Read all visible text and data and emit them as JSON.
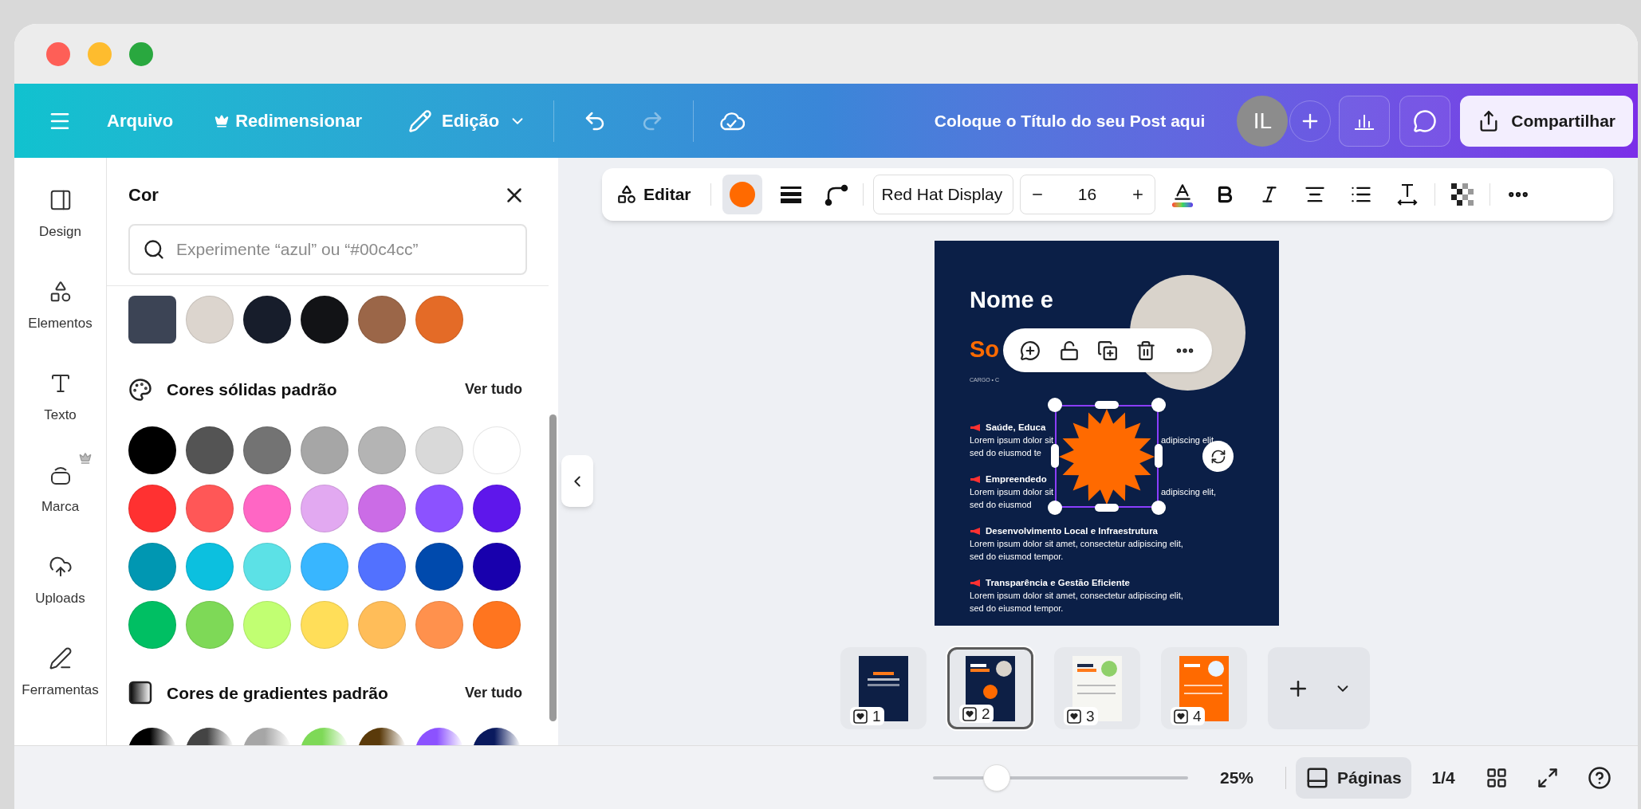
{
  "window": {
    "traffic_lights": [
      {
        "color": "#fe5f57"
      },
      {
        "color": "#febc2e"
      },
      {
        "color": "#29a83f"
      }
    ]
  },
  "top_bar": {
    "file_menu": "Arquivo",
    "resize": "Redimensionar",
    "edit_mode": "Edição",
    "redo": {
      "disabled": true
    },
    "title": "Coloque o Título do seu Post aqui",
    "avatar_initials": "IL",
    "share": "Compartilhar"
  },
  "sidebar": {
    "items": [
      {
        "label": "Design",
        "premium": false
      },
      {
        "label": "Elementos",
        "premium": false
      },
      {
        "label": "Texto",
        "premium": false
      },
      {
        "label": "Marca",
        "premium": true
      },
      {
        "label": "Uploads",
        "premium": false
      },
      {
        "label": "Ferramentas",
        "premium": false
      }
    ]
  },
  "color_panel": {
    "title": "Cor",
    "search": {
      "placeholder": "Experimente “azul” ou “#00c4cc”"
    },
    "document_colors": [
      {
        "kind": "photo"
      },
      {
        "kind": "color",
        "color": "#dcd5ce"
      },
      {
        "kind": "color",
        "color": "#171d2b"
      },
      {
        "kind": "color",
        "color": "#121316"
      },
      {
        "kind": "color",
        "color": "#9b6648"
      },
      {
        "kind": "color",
        "color": "#e46b27"
      }
    ],
    "solid": {
      "title": "Cores sólidas padrão",
      "see_all": "Ver tudo",
      "swatches": [
        {
          "color": "#000000"
        },
        {
          "color": "#545454"
        },
        {
          "color": "#737373"
        },
        {
          "color": "#a6a6a6"
        },
        {
          "color": "#b4b4b4"
        },
        {
          "color": "#d9d9d9"
        },
        {
          "color": "#ffffff"
        },
        {
          "color": "#ff3131"
        },
        {
          "color": "#ff5757"
        },
        {
          "color": "#ff66c4"
        },
        {
          "color": "#e2a9f1"
        },
        {
          "color": "#cb6ce6"
        },
        {
          "color": "#8c52ff"
        },
        {
          "color": "#5e17eb"
        },
        {
          "color": "#0097b2"
        },
        {
          "color": "#0cc0df"
        },
        {
          "color": "#5ce1e6"
        },
        {
          "color": "#38b6ff"
        },
        {
          "color": "#5271ff"
        },
        {
          "color": "#004aad"
        },
        {
          "color": "#1800ad"
        },
        {
          "color": "#00bf63"
        },
        {
          "color": "#7ed957"
        },
        {
          "color": "#c1ff72"
        },
        {
          "color": "#ffde59"
        },
        {
          "color": "#ffbd59"
        },
        {
          "color": "#ff914d"
        },
        {
          "color": "#ff751f"
        }
      ]
    },
    "gradients": {
      "title": "Cores de gradientes padrão",
      "see_all": "Ver tudo",
      "swatches": [
        {
          "color": "#000000"
        },
        {
          "color": "#444444"
        },
        {
          "color": "#a6a6a6"
        },
        {
          "color": "#7ed957"
        },
        {
          "color": "#5a3a0a"
        },
        {
          "color": "#8c52ff"
        },
        {
          "color": "#0a1a5e"
        }
      ]
    }
  },
  "toolbar": {
    "edit": "Editar",
    "fill": {
      "color": "#ff6a00"
    },
    "font": "Red Hat Display",
    "font_size": "16"
  },
  "design": {
    "name_line_1": "Nome e",
    "name_line_2": "So",
    "subtitle": "CARGO • C",
    "shape": {
      "color": "#ff6a00"
    },
    "sections": [
      {
        "heading": "Saúde, Educa",
        "lines": [
          [
            "Lorem ipsum dolor sit",
            "adipiscing elit,"
          ],
          [
            "sed do eiusmod te"
          ]
        ]
      },
      {
        "heading": "Empreendedo",
        "lines": [
          [
            "Lorem ipsum dolor sit",
            "adipiscing elit,"
          ],
          [
            "sed do eiusmod"
          ]
        ]
      },
      {
        "heading": "Desenvolvimento Local e Infraestrutura",
        "lines": [
          [
            "Lorem ipsum dolor sit amet, consectetur adipiscing elit,"
          ],
          [
            "sed do eiusmod tempor."
          ]
        ]
      },
      {
        "heading": "Transparência e Gestão Eficiente",
        "lines": [
          [
            "Lorem ipsum dolor sit amet, consectetur adipiscing elit,"
          ],
          [
            "sed do eiusmod tempor."
          ]
        ]
      }
    ]
  },
  "pages": [
    {
      "number": "1",
      "kind": "dark",
      "selected": false
    },
    {
      "number": "2",
      "kind": "dark_photo",
      "selected": true
    },
    {
      "number": "3",
      "kind": "light",
      "selected": false
    },
    {
      "number": "4",
      "kind": "orange",
      "selected": false
    }
  ],
  "footer": {
    "zoom": {
      "level": 0.25,
      "reading": "25%"
    },
    "pages_button": "Páginas",
    "page_count": "1/4"
  }
}
